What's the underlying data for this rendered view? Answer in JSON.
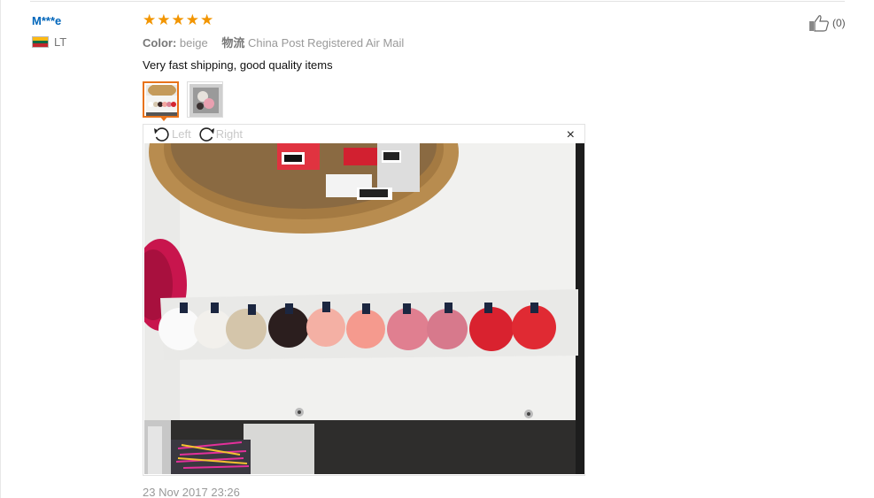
{
  "review": {
    "reviewer_name": "M***e",
    "country_code": "LT",
    "rating": 5,
    "color_label": "Color:",
    "color_value": "beige",
    "shipping_label": "物流",
    "shipping_value": "China Post Registered Air Mail",
    "feedback_text": "Very fast shipping, good quality items",
    "date": "23 Nov 2017 23:26",
    "helpful_count": "(0)",
    "flag_colors": [
      "#fdb913",
      "#006a44",
      "#c1272d"
    ]
  },
  "viewer": {
    "rotate_left_label": "Left",
    "rotate_right_label": "Right",
    "close_label": "×"
  },
  "colors": {
    "star": "#f29500",
    "name_link": "#0066bb",
    "active_thumb_border": "#e8731a"
  },
  "icons": [
    "star-icon",
    "rotate-left-icon",
    "rotate-right-icon",
    "close-icon",
    "thumbs-up-icon",
    "flag-lt-icon"
  ]
}
